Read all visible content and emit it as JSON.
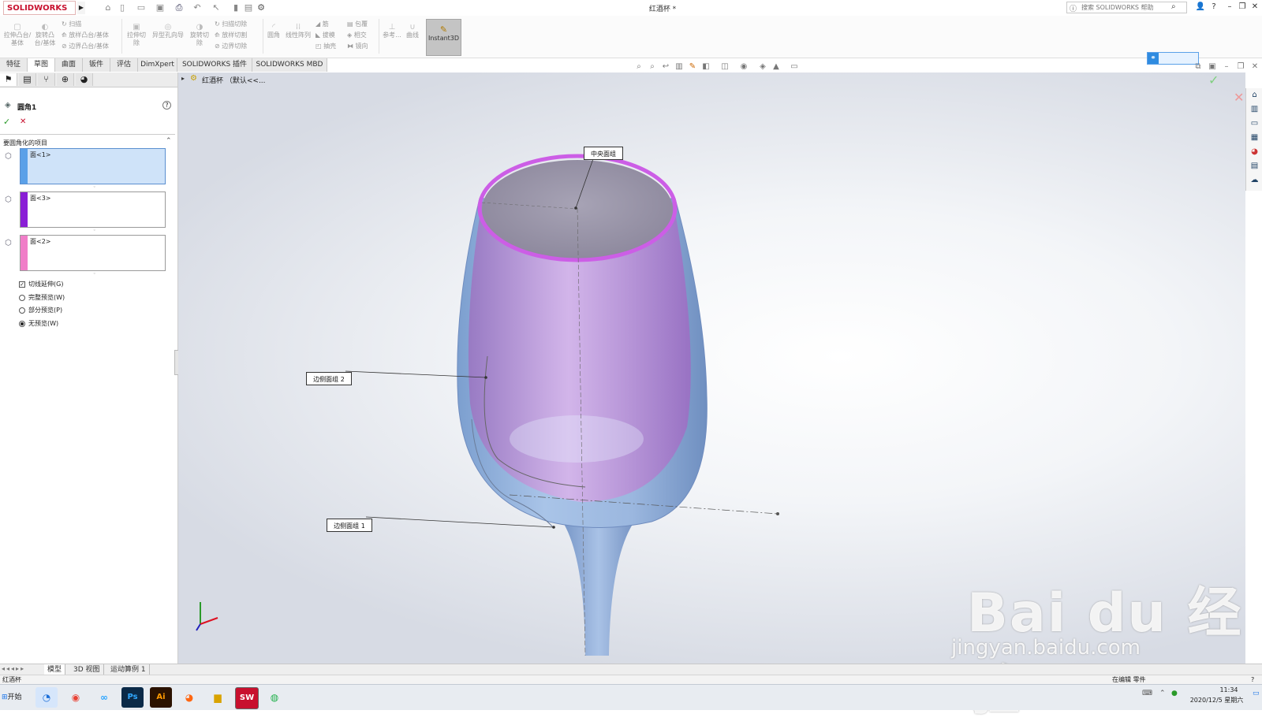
{
  "app": {
    "logo_text": "SOLIDWORKS",
    "document_title": "红酒杯 *",
    "search_placeholder": "搜索 SOLIDWORKS 帮助"
  },
  "command_manager": {
    "items": [
      {
        "label": "拉伸凸台/基体"
      },
      {
        "label": "旋转凸台/基体"
      },
      {
        "label": "扫描"
      },
      {
        "label": "放样凸台/基体"
      },
      {
        "label": "边界凸台/基体"
      },
      {
        "label": "拉伸切除"
      },
      {
        "label": "异型孔向导"
      },
      {
        "label": "旋转切除"
      },
      {
        "label": "扫描切除"
      },
      {
        "label": "放样切割"
      },
      {
        "label": "边界切除"
      },
      {
        "label": "圆角"
      },
      {
        "label": "线性阵列"
      },
      {
        "label": "筋"
      },
      {
        "label": "拔模"
      },
      {
        "label": "抽壳"
      },
      {
        "label": "包覆"
      },
      {
        "label": "相交"
      },
      {
        "label": "镜向"
      },
      {
        "label": "参考..."
      },
      {
        "label": "曲线"
      }
    ],
    "instant3d_label": "Instant3D"
  },
  "tabs": [
    "特征",
    "草图",
    "曲面",
    "钣件",
    "评估",
    "DimXpert",
    "SOLIDWORKS 插件",
    "SOLIDWORKS MBD"
  ],
  "active_tab_index": 1,
  "feature_tree_root": "红酒杯 （默认<<...",
  "property_manager": {
    "title": "圆角1",
    "ok_symbol": "✓",
    "cancel_symbol": "✕",
    "help_symbol": "?",
    "section_title": "要圆角化的项目",
    "selections": [
      {
        "text": "面<1>",
        "color": "#5aa0e8",
        "active": true
      },
      {
        "text": "面<3>",
        "color": "#8a1fd6",
        "active": false
      },
      {
        "text": "面<2>",
        "color": "#f07ec8",
        "active": false
      }
    ],
    "options": [
      {
        "label": "切线延伸(G)",
        "type": "checkbox",
        "checked": true
      },
      {
        "label": "完整预览(W)",
        "type": "radio",
        "checked": false
      },
      {
        "label": "部分预览(P)",
        "type": "radio",
        "checked": false
      },
      {
        "label": "无预览(W)",
        "type": "radio",
        "checked": true
      }
    ]
  },
  "callouts": {
    "top": "中央面组",
    "middle": "边侧面组 2",
    "bottom": "边侧面组 1"
  },
  "bottom_tabs": [
    "模型",
    "3D 视图",
    "运动算例 1"
  ],
  "status": {
    "left": "红酒杯",
    "right": "在编辑  零件"
  },
  "taskbar": {
    "start_label": "开始",
    "clock_time": "11:34",
    "clock_date": "2020/12/5 星期六",
    "apps": [
      "browser",
      "chrome",
      "baidu-netdisk",
      "Ps",
      "Ai",
      "firefox",
      "explorer",
      "SW",
      "wechat"
    ]
  },
  "watermark": {
    "brand": "Bai du 经验",
    "url": "jingyan.baidu.com"
  },
  "colors": {
    "glass_outer": "#8fb1dd",
    "glass_inner": "#b78fd4",
    "rim": "#cc5ee6",
    "accent": "#c8102e"
  }
}
